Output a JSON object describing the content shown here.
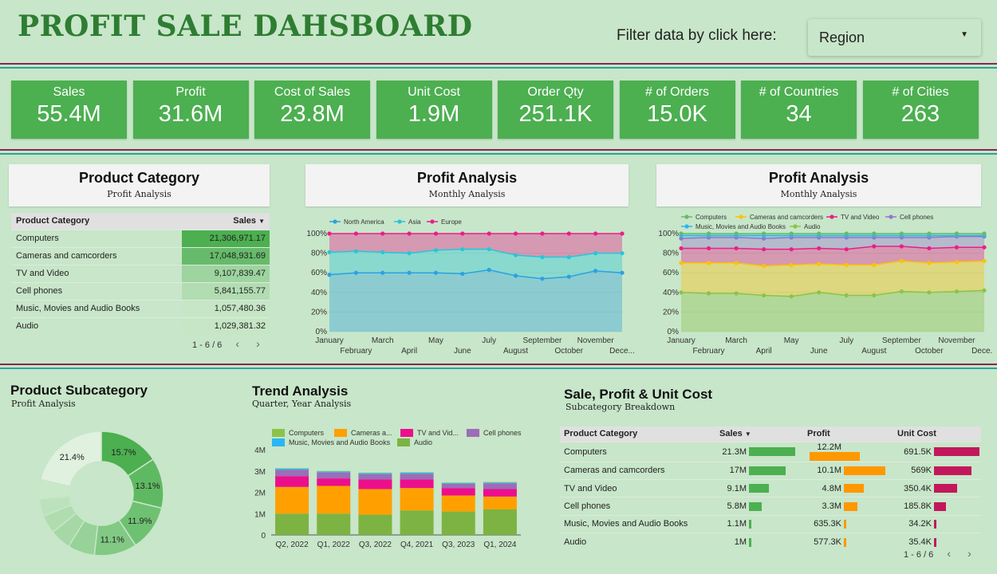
{
  "header": {
    "title": "PROFIT SALE DAHSBOARD",
    "filter_label": "Filter data by click here:",
    "filter_value": "Region"
  },
  "kpis": [
    {
      "label": "Sales",
      "value": "55.4M"
    },
    {
      "label": "Profit",
      "value": "31.6M"
    },
    {
      "label": "Cost of Sales",
      "value": "23.8M"
    },
    {
      "label": "Unit Cost",
      "value": "1.9M"
    },
    {
      "label": "Order Qty",
      "value": "251.1K"
    },
    {
      "label": "# of Orders",
      "value": "15.0K"
    },
    {
      "label": "# of Countries",
      "value": "34"
    },
    {
      "label": "# of Cities",
      "value": "263"
    }
  ],
  "product_category": {
    "title": "Product Category",
    "subtitle": "Profit Analysis",
    "columns": [
      "Product Category",
      "Sales"
    ],
    "rows": [
      {
        "name": "Computers",
        "sales": "21,306,971.17",
        "shade": "#4caf50"
      },
      {
        "name": "Cameras and camcorders",
        "sales": "17,048,931.69",
        "shade": "#66bb6a"
      },
      {
        "name": "TV and Video",
        "sales": "9,107,839.47",
        "shade": "#9ed49f"
      },
      {
        "name": "Cell phones",
        "sales": "5,841,155.77",
        "shade": "#b2dcb2"
      },
      {
        "name": "Music, Movies and Audio Books",
        "sales": "1,057,480.36",
        "shade": "#c6e6c6"
      },
      {
        "name": "Audio",
        "sales": "1,029,381.32",
        "shade": "#c6e6c6"
      }
    ],
    "pager": "1 - 6 / 6"
  },
  "profit_region": {
    "title": "Profit Analysis",
    "subtitle": "Monthly Analysis"
  },
  "profit_category": {
    "title": "Profit Analysis",
    "subtitle": "Monthly Analysis"
  },
  "subcategory": {
    "title": "Product Subcategory",
    "subtitle": "Profit Analysis"
  },
  "trend": {
    "title": "Trend Analysis",
    "subtitle": "Quarter, Year Analysis"
  },
  "breakdown": {
    "title": "Sale, Profit & Unit Cost",
    "subtitle": "Subcategory Breakdown",
    "columns": [
      "Product Category",
      "Sales",
      "Profit",
      "Unit Cost"
    ],
    "rows": [
      {
        "name": "Computers",
        "sales": "21.3M",
        "profit": "12.2M",
        "unit_cost": "691.5K",
        "s": 21.3,
        "p": 12.2,
        "u": 691.5
      },
      {
        "name": "Cameras and camcorders",
        "sales": "17M",
        "profit": "10.1M",
        "unit_cost": "569K",
        "s": 17,
        "p": 10.1,
        "u": 569
      },
      {
        "name": "TV and Video",
        "sales": "9.1M",
        "profit": "4.8M",
        "unit_cost": "350.4K",
        "s": 9.1,
        "p": 4.8,
        "u": 350.4
      },
      {
        "name": "Cell phones",
        "sales": "5.8M",
        "profit": "3.3M",
        "unit_cost": "185.8K",
        "s": 5.8,
        "p": 3.3,
        "u": 185.8
      },
      {
        "name": "Music, Movies and Audio Books",
        "sales": "1.1M",
        "profit": "635.3K",
        "unit_cost": "34.2K",
        "s": 1.1,
        "p": 0.6353,
        "u": 34.2
      },
      {
        "name": "Audio",
        "sales": "1M",
        "profit": "577.3K",
        "unit_cost": "35.4K",
        "s": 1,
        "p": 0.5773,
        "u": 35.4
      }
    ],
    "pager": "1 - 6 / 6",
    "colors": {
      "sales": "#4caf50",
      "profit": "#ff9800",
      "unit_cost": "#c2185b"
    }
  },
  "chart_data": [
    {
      "id": "region",
      "type": "area",
      "stacked": "percent",
      "x": [
        "January",
        "February",
        "March",
        "April",
        "May",
        "June",
        "July",
        "August",
        "September",
        "October",
        "November",
        "Dece..."
      ],
      "series": [
        {
          "name": "North America",
          "color": "#29a3e0",
          "values": [
            58,
            60,
            60,
            60,
            60,
            59,
            63,
            57,
            54,
            56,
            62,
            60
          ]
        },
        {
          "name": "Asia",
          "color": "#26c6da",
          "values": [
            23,
            22,
            21,
            20,
            23,
            25,
            21,
            21,
            22,
            20,
            18,
            20
          ]
        },
        {
          "name": "Europe",
          "color": "#e91e8c",
          "values": [
            19,
            18,
            19,
            20,
            17,
            16,
            16,
            22,
            24,
            24,
            20,
            20
          ]
        }
      ],
      "yticks": [
        "0%",
        "20%",
        "40%",
        "60%",
        "80%",
        "100%"
      ],
      "ylim": [
        0,
        100
      ]
    },
    {
      "id": "category",
      "type": "area",
      "stacked": "percent",
      "x": [
        "January",
        "February",
        "March",
        "April",
        "May",
        "June",
        "July",
        "August",
        "September",
        "October",
        "November",
        "Dece..."
      ],
      "series": [
        {
          "name": "Audio",
          "color": "#8bc34a",
          "values": [
            40,
            39,
            39,
            37,
            36,
            40,
            37,
            37,
            41,
            40,
            41,
            42
          ]
        },
        {
          "name": "Cameras and camcorders",
          "color": "#ffc107",
          "values": [
            30,
            31,
            31,
            30,
            32,
            29,
            31,
            31,
            31,
            30,
            30,
            30
          ]
        },
        {
          "name": "TV and Video",
          "color": "#e91e8c",
          "values": [
            15,
            15,
            15,
            17,
            16,
            16,
            16,
            19,
            15,
            15,
            15,
            14
          ]
        },
        {
          "name": "Cell phones",
          "color": "#9575cd",
          "values": [
            10,
            11,
            11,
            11,
            12,
            11,
            12,
            9,
            9,
            11,
            11,
            11
          ]
        },
        {
          "name": "Music, Movies and Audio Books",
          "color": "#29b6f6",
          "values": [
            3,
            2,
            2,
            3,
            2,
            2,
            2,
            2,
            2,
            2,
            1,
            1
          ]
        },
        {
          "name": "Computers",
          "color": "#66bb6a",
          "values": [
            2,
            2,
            2,
            2,
            2,
            2,
            2,
            2,
            2,
            2,
            2,
            2
          ]
        }
      ],
      "legend_order": [
        "Computers",
        "Cameras and camcorders",
        "TV and Video",
        "Cell phones",
        "Music, Movies and Audio Books",
        "Audio"
      ],
      "yticks": [
        "0%",
        "20%",
        "40%",
        "60%",
        "80%",
        "100%"
      ],
      "ylim": [
        0,
        100
      ]
    },
    {
      "id": "subcategory",
      "type": "pie",
      "donut": true,
      "slices": [
        {
          "value": 15.7,
          "label": "15.7%",
          "color": "#4caf50"
        },
        {
          "value": 13.1,
          "label": "13.1%",
          "color": "#5fb962"
        },
        {
          "value": 11.9,
          "label": "11.9%",
          "color": "#6fc172"
        },
        {
          "value": 11.1,
          "label": "11.1%",
          "color": "#82c984"
        },
        {
          "value": 7.0,
          "label": "",
          "color": "#97d298"
        },
        {
          "value": 5.5,
          "label": "",
          "color": "#a5d8a6"
        },
        {
          "value": 4.8,
          "label": "",
          "color": "#b0ddb0"
        },
        {
          "value": 4.5,
          "label": "",
          "color": "#bce2bc"
        },
        {
          "value": 5.0,
          "label": "",
          "color": "#c9e8c9"
        },
        {
          "value": 21.4,
          "label": "21.4%",
          "color": "#e0f1e0"
        }
      ]
    },
    {
      "id": "trend",
      "type": "bar",
      "stacked": true,
      "categories": [
        "Q2, 2022",
        "Q1, 2022",
        "Q3, 2022",
        "Q4, 2021",
        "Q3, 2023",
        "Q1, 2024"
      ],
      "series": [
        {
          "name": "Audio",
          "color": "#7cb342",
          "values": [
            1.0,
            1.0,
            0.95,
            1.15,
            1.1,
            1.2
          ]
        },
        {
          "name": "Cameras a...",
          "color": "#ffa000",
          "values": [
            1.25,
            1.3,
            1.2,
            1.05,
            0.75,
            0.6
          ]
        },
        {
          "name": "TV and Vid...",
          "color": "#ec0f8c",
          "values": [
            0.5,
            0.35,
            0.45,
            0.4,
            0.35,
            0.35
          ]
        },
        {
          "name": "Cell phones",
          "color": "#9c6db8",
          "values": [
            0.3,
            0.28,
            0.25,
            0.27,
            0.2,
            0.27
          ]
        },
        {
          "name": "Music, Movies and Audio Books",
          "color": "#29b6f6",
          "values": [
            0.06,
            0.05,
            0.05,
            0.05,
            0.04,
            0.04
          ]
        },
        {
          "name": "Computers",
          "color": "#8bc34a",
          "values": [
            0.02,
            0.02,
            0.02,
            0.02,
            0.02,
            0.02
          ]
        }
      ],
      "legend_order": [
        "Computers",
        "Cameras a...",
        "TV and Vid...",
        "Cell phones",
        "Music, Movies and Audio Books",
        "Audio"
      ],
      "yticks": [
        "0",
        "1M",
        "2M",
        "3M",
        "4M"
      ],
      "ylim": [
        0,
        4
      ]
    }
  ]
}
